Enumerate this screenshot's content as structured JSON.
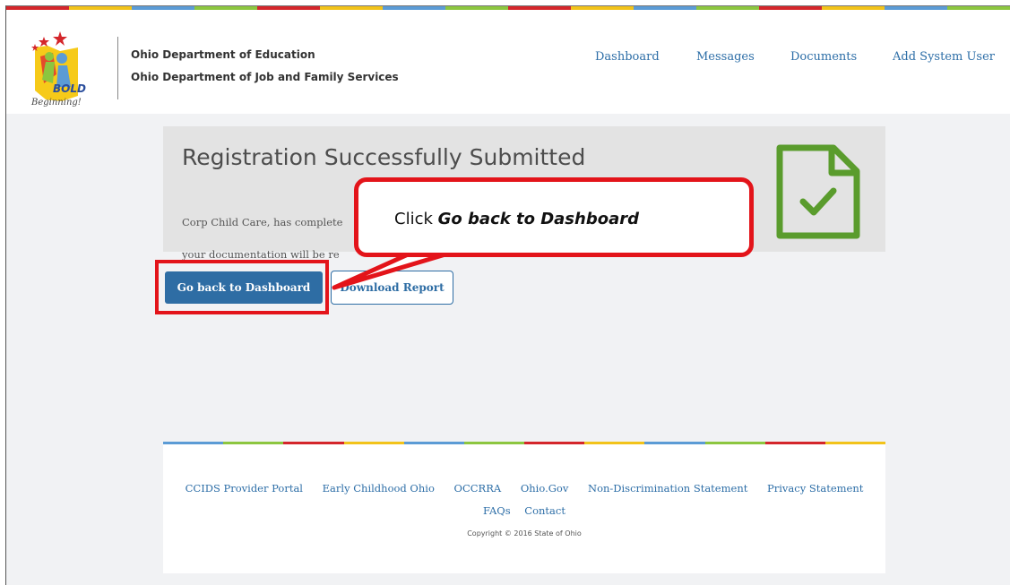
{
  "header": {
    "logo_text_bold": "BOLD",
    "logo_text_script": "Beginning!",
    "agency_line1": "Ohio Department of Education",
    "agency_line2": "Ohio Department of Job and Family Services",
    "nav": [
      {
        "label": "Dashboard"
      },
      {
        "label": "Messages"
      },
      {
        "label": "Documents"
      },
      {
        "label": "Add System User"
      }
    ]
  },
  "main": {
    "title": "Registration Successfully Submitted",
    "body_line1": "Corp Child Care, has complete",
    "body_line2": "your documentation will be re",
    "primary_button": "Go back to Dashboard",
    "secondary_button": "Download Report"
  },
  "annotation": {
    "prefix": "Click ",
    "emphasis": "Go back to Dashboard",
    "color": "#e3141a"
  },
  "footer": {
    "links": [
      "CCIDS Provider Portal",
      "Early Childhood Ohio",
      "OCCRRA",
      "Ohio.Gov",
      "Non-Discrimination Statement",
      "Privacy Statement"
    ],
    "links2": [
      "FAQs",
      "Contact"
    ],
    "copyright": "Copyright © 2016 State of Ohio"
  },
  "colors": {
    "accent": "#2e6da4",
    "stripe": [
      "#d4262b",
      "#f2c31a",
      "#5b9bd5",
      "#8cc63f"
    ],
    "check_icon": "#5a9c2d"
  },
  "icons": {
    "document_check": "document-check-icon"
  }
}
